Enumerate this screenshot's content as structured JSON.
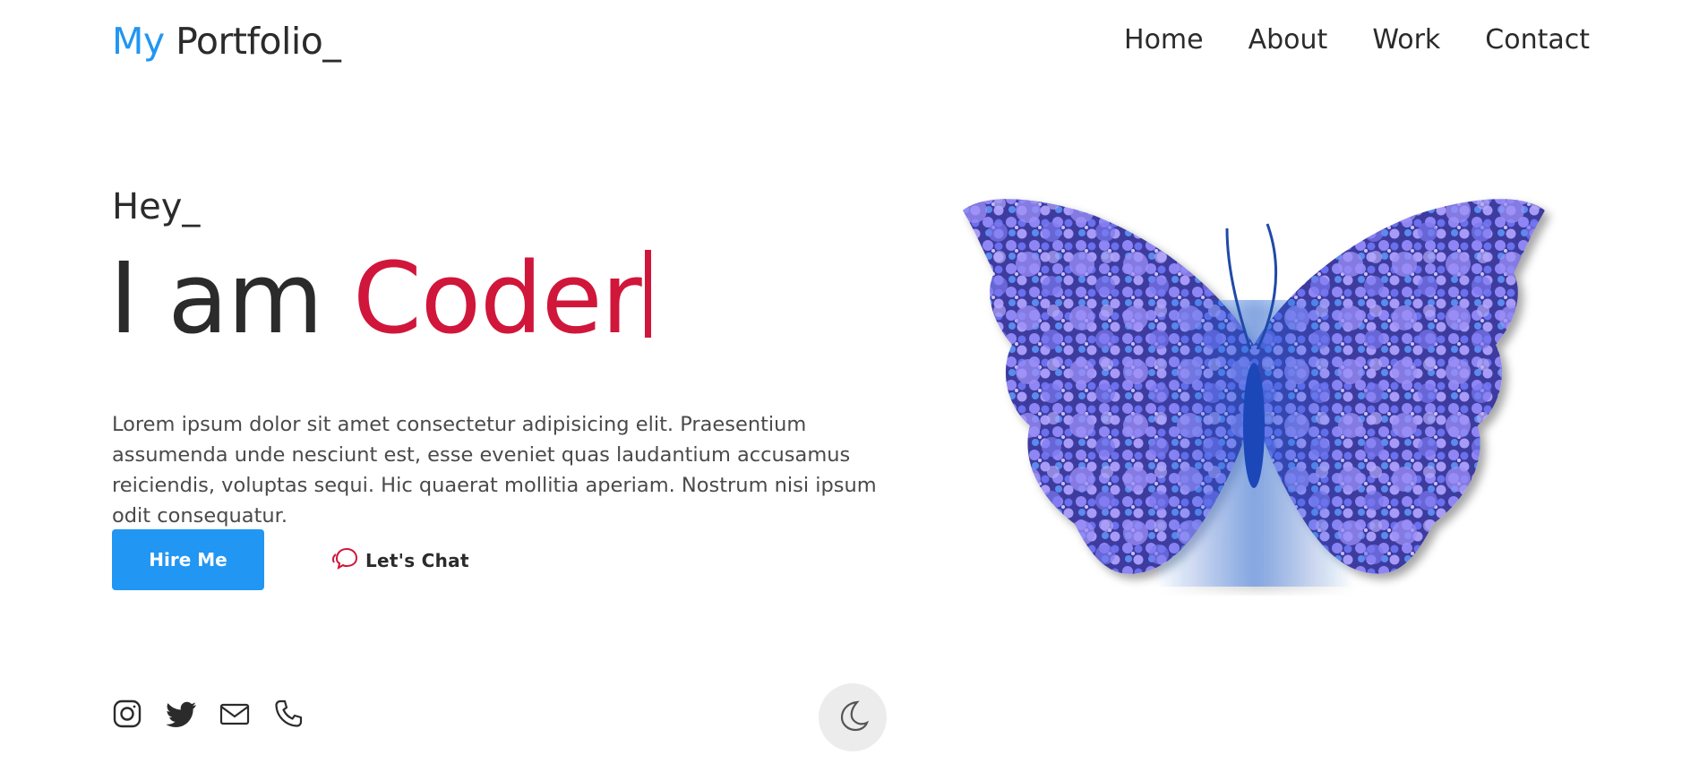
{
  "header": {
    "logo_accent": "My",
    "logo_rest": " Portfolio_",
    "nav": [
      {
        "label": "Home"
      },
      {
        "label": "About"
      },
      {
        "label": "Work"
      },
      {
        "label": "Contact"
      }
    ]
  },
  "hero": {
    "greeting": "Hey_",
    "intro": "I am ",
    "role": "Coder",
    "description": "Lorem ipsum dolor sit amet consectetur adipisicing elit. Praesentium assumenda unde nesciunt est, esse eveniet quas laudantium accusamus reiciendis, voluptas sequi. Hic quaerat mollitia aperiam. Nostrum nisi ipsum odit consequatur.",
    "hire_label": "Hire Me",
    "chat_label": "Let's Chat"
  },
  "socials": {
    "icons": [
      "instagram-icon",
      "twitter-icon",
      "mail-icon",
      "phone-icon"
    ]
  },
  "theme": {
    "toggle_icon": "moon-icon"
  },
  "colors": {
    "accent": "#2196f3",
    "role": "#d0163a",
    "text": "#2b2b2b",
    "toggle_bg": "#ececec"
  }
}
